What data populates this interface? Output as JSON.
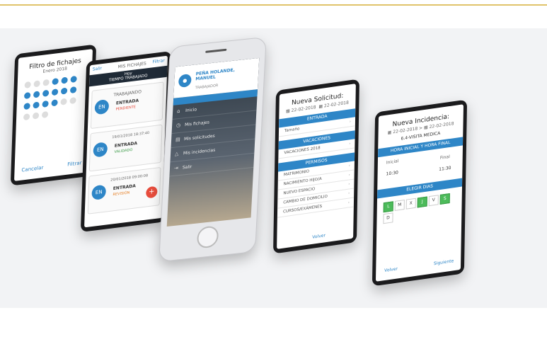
{
  "calendar": {
    "title": "Filtro de fichajes",
    "month": "Enero 2018",
    "cancel": "Cancelar",
    "filter": "Filtrar"
  },
  "list": {
    "left_link": "Salir",
    "right_link": "Filtrar",
    "header_top": "MIS FICHAJES",
    "header_date": "Hoy",
    "header_time": "TIEMPO TRABAJADO",
    "cards": [
      {
        "avatar": "EN",
        "date": "TRABAJANDO",
        "type": "ENTRADA",
        "status": "PENDIENTE"
      },
      {
        "avatar": "EN",
        "date": "19/01/2018 18:37:40",
        "type": "ENTRADA",
        "status": "VALIDADO"
      },
      {
        "avatar": "EN",
        "date": "20/01/2018 09:00:08",
        "type": "ENTRADA",
        "status": "REVISIÓN"
      }
    ],
    "fab": "+"
  },
  "menu": {
    "user_name": "PEÑA HOLANDE, MANUEL",
    "user_role": "TRABAJADOR",
    "items": [
      "Inicio",
      "Mis fichajes",
      "Mis solicitudes",
      "Mis incidencias",
      "Salir"
    ]
  },
  "solicitud": {
    "title": "Nueva Solicitud:",
    "date_from": "22-02-2018",
    "date_to": "22-02-2018",
    "section1": "ENTRADA",
    "select1": "Tamaño",
    "section2": "VACACIONES",
    "select2": "VACACIONES 2018",
    "section3": "PERMISOS",
    "options": [
      "MATRIMONIO",
      "NACIMIENTO HIJO/A",
      "NUEVO ESPACIO",
      "CAMBIO DE DOMICILIO",
      "CURSOS/EXÁMENES"
    ],
    "back": "Volver"
  },
  "incidencia": {
    "title": "Nueva Incidencia:",
    "date_from": "22-02-2018",
    "date_to": "22-02-2018",
    "reason": "6.4-VISITA MEDICA",
    "section_hours": "HORA INICIAL Y HORA FINAL",
    "start_label": "Inicial",
    "end_label": "Final",
    "start_value": "10:30",
    "end_value": "11:30",
    "section_days": "ELEGIR DIAS",
    "days": [
      "L",
      "M",
      "X",
      "J",
      "V",
      "S",
      "D"
    ],
    "back": "Volver",
    "next": "Siguiente"
  }
}
